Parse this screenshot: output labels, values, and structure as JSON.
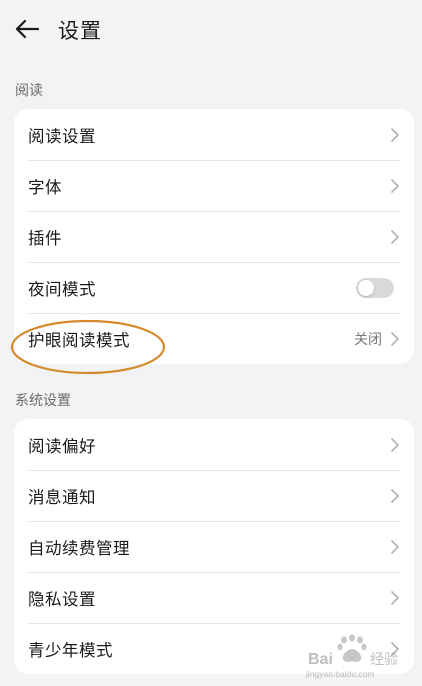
{
  "header": {
    "title": "设置",
    "back_icon": "arrow-left-icon"
  },
  "sections": {
    "reading": {
      "label": "阅读",
      "items": [
        {
          "label": "阅读设置"
        },
        {
          "label": "字体"
        },
        {
          "label": "插件"
        },
        {
          "label": "夜间模式",
          "toggle_on": false
        },
        {
          "label": "护眼阅读模式",
          "value": "关闭"
        }
      ]
    },
    "system": {
      "label": "系统设置",
      "items": [
        {
          "label": "阅读偏好"
        },
        {
          "label": "消息通知"
        },
        {
          "label": "自动续费管理"
        },
        {
          "label": "隐私设置"
        },
        {
          "label": "青少年模式"
        }
      ]
    }
  },
  "annotation": {
    "color": "#d48a2a"
  },
  "watermark": {
    "text": "Baidu经验",
    "subtext": "jingyan.baidu.com"
  }
}
